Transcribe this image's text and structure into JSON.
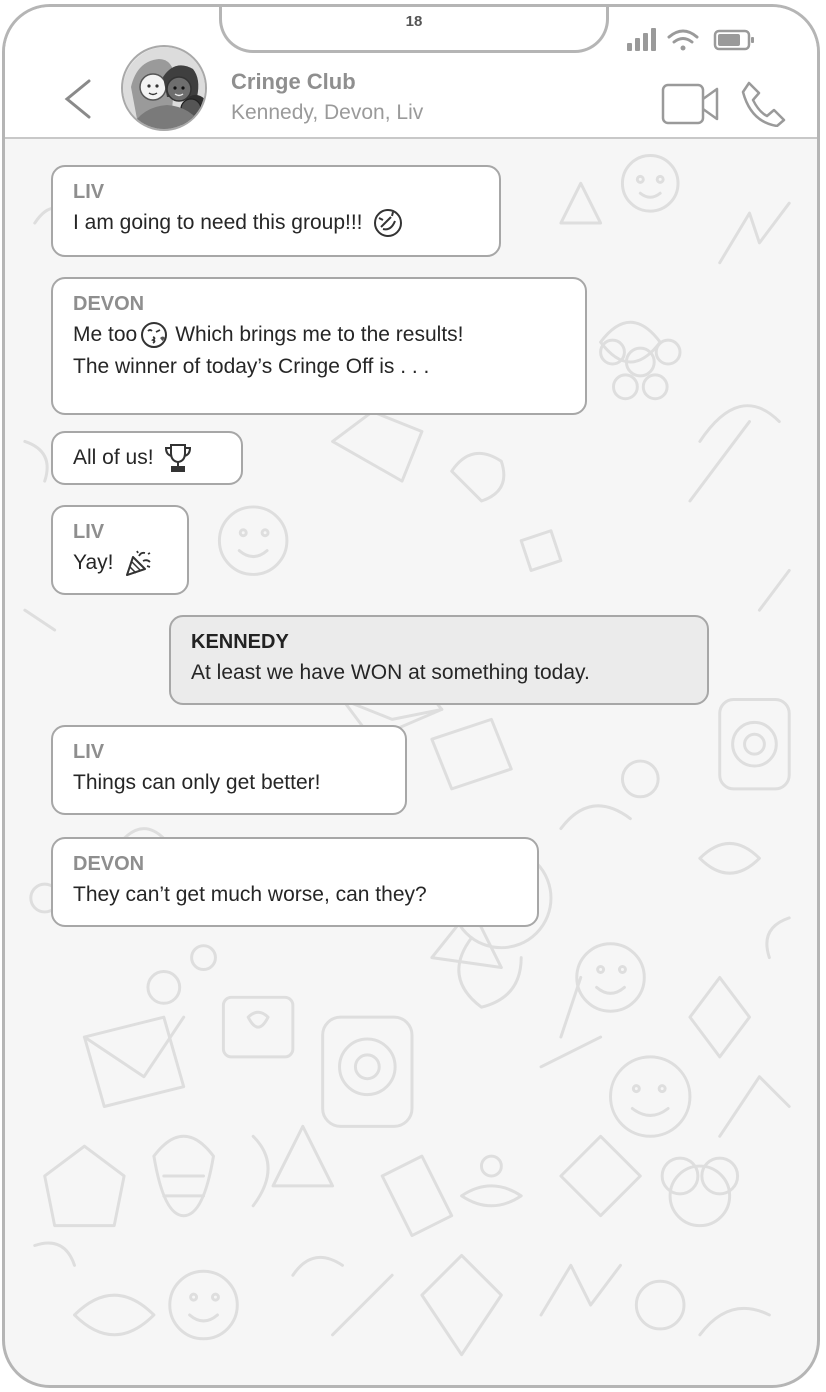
{
  "status_bar": {
    "page_number": "18"
  },
  "header": {
    "back_icon": "chevron-left-icon",
    "chat_name": "Cringe Club",
    "members": "Kennedy, Devon, Liv",
    "video_icon": "video-camera-icon",
    "call_icon": "phone-icon"
  },
  "messages": [
    {
      "sender": "LIV",
      "lines": [
        "I am going to need this group!!!"
      ],
      "emoji": "rofl-emoji"
    },
    {
      "sender": "DEVON",
      "lines": [
        "Me too",
        "Which brings me to the results!",
        "The winner of today’s Cringe Off is . . ."
      ],
      "emoji": "kiss-emoji"
    },
    {
      "sender": "",
      "lines": [
        "All of us!"
      ],
      "emoji": "trophy-emoji"
    },
    {
      "sender": "LIV",
      "lines": [
        "Yay!"
      ],
      "emoji": "party-popper-emoji"
    },
    {
      "sender": "KENNEDY",
      "lines": [
        "At least we have WON at something today."
      ],
      "outgoing": true
    },
    {
      "sender": "LIV",
      "lines": [
        "Things can only get better!"
      ]
    },
    {
      "sender": "DEVON",
      "lines": [
        "They can’t get much worse, can they?"
      ]
    }
  ],
  "colors": {
    "border": "#a7a7a7",
    "sent_bubble": "#ebebeb",
    "background": "#f6f6f6"
  }
}
